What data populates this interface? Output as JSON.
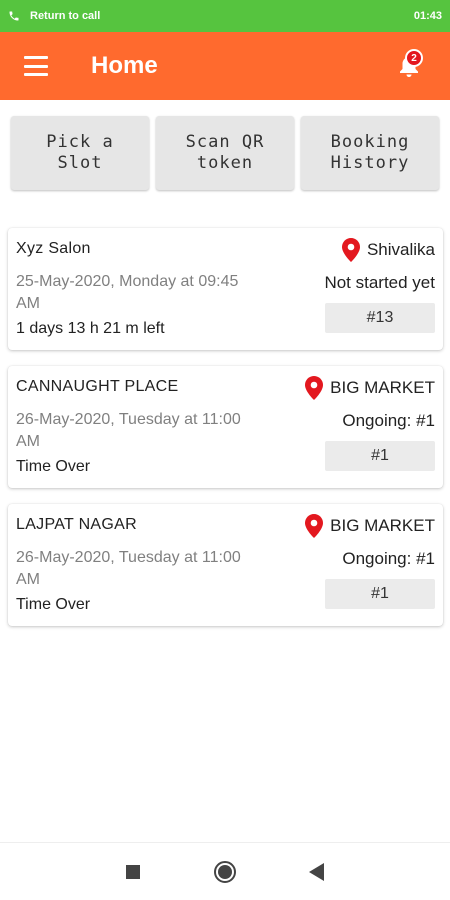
{
  "status_bar": {
    "call_label": "Return to call",
    "time": "01:43",
    "icon": "phone-icon"
  },
  "app_bar": {
    "title": "Home",
    "menu_icon": "menu-icon",
    "bell_icon": "bell-icon",
    "notification_count": "2"
  },
  "actions": [
    {
      "label": "Pick a\nSlot"
    },
    {
      "label": "Scan QR\ntoken"
    },
    {
      "label": "Booking\nHistory"
    }
  ],
  "bookings": [
    {
      "name": "Xyz Salon",
      "datetime": "25-May-2020, Monday at 09:45 AM",
      "remaining": "1 days 13 h 21 m left",
      "location": "Shivalika",
      "status": "Not started yet",
      "token": "#13"
    },
    {
      "name": "CANNAUGHT PLACE",
      "datetime": "26-May-2020, Tuesday at 11:00 AM",
      "remaining": "Time Over",
      "location": "BIG MARKET",
      "status": "Ongoing: #1",
      "token": "#1"
    },
    {
      "name": "LAJPAT NAGAR",
      "datetime": "26-May-2020, Tuesday at 11:00 AM",
      "remaining": "Time Over",
      "location": "BIG MARKET",
      "status": "Ongoing: #1",
      "token": "#1"
    }
  ],
  "colors": {
    "status_bar": "#56c43f",
    "app_bar": "#ff6a2e",
    "pin": "#e3181f"
  },
  "nav": {
    "recents_icon": "square-icon",
    "home_icon": "circle-icon",
    "back_icon": "triangle-back-icon"
  }
}
